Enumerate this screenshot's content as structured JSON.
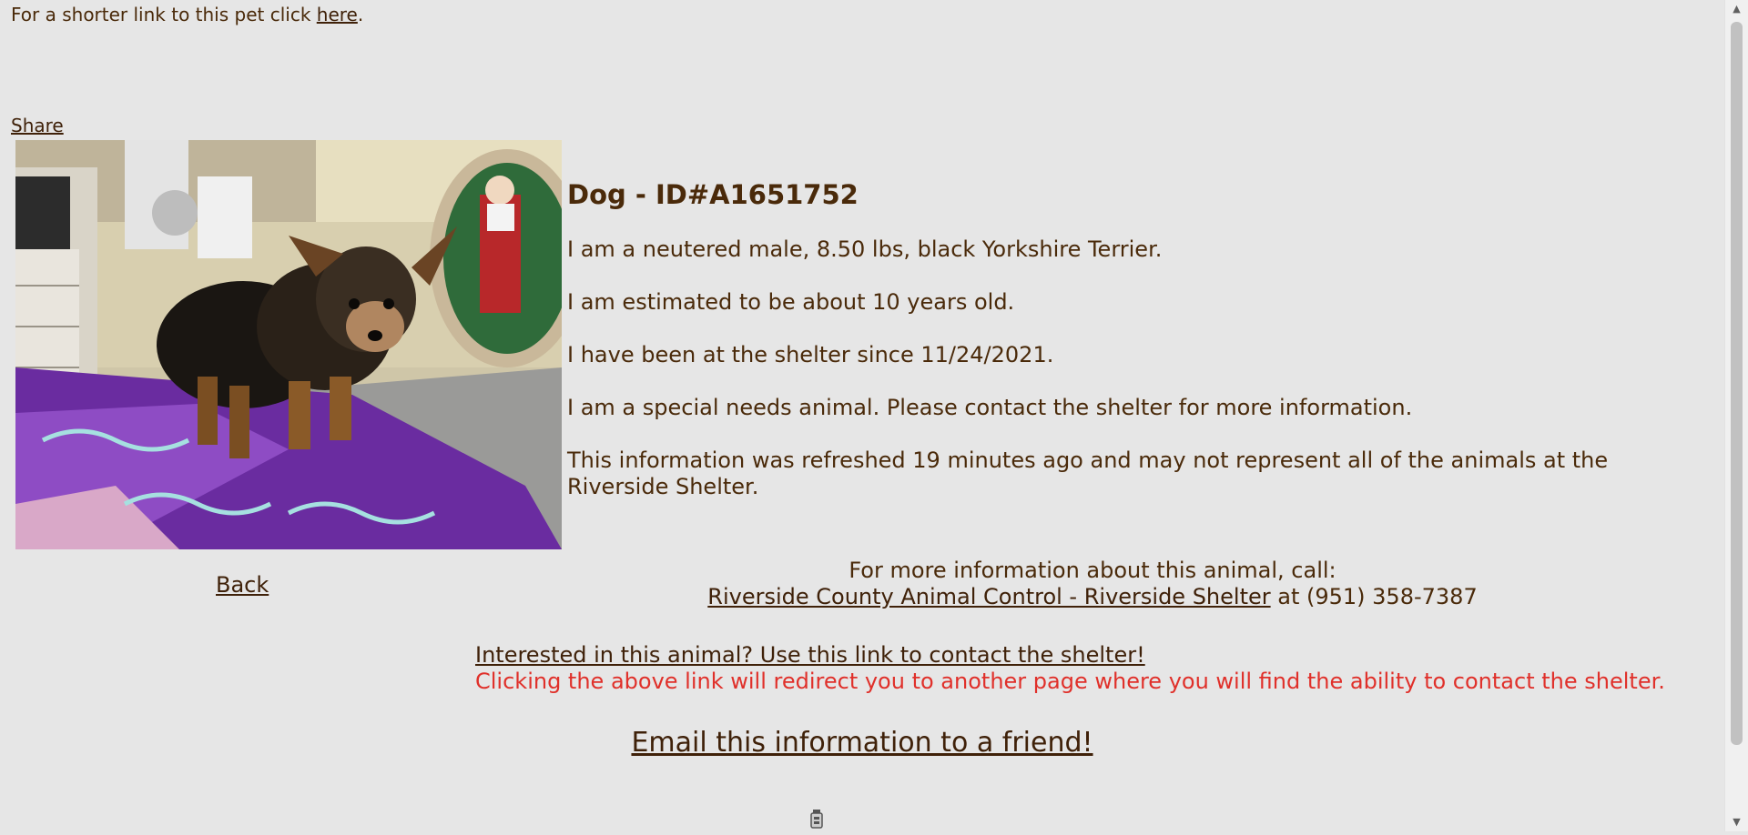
{
  "top": {
    "prefix": "For a shorter link to this pet click ",
    "here_link": "here",
    "suffix": "."
  },
  "share_label": "Share",
  "back_label": "Back",
  "animal": {
    "title": "Dog - ID#A1651752",
    "lines": [
      "I am a neutered male, 8.50 lbs, black Yorkshire Terrier.",
      "I am estimated to be about 10 years old.",
      "I have been at the shelter since 11/24/2021.",
      "I am a special needs animal. Please contact the shelter for more information.",
      "This information was refreshed 19 minutes ago and may not represent all of the animals at the Riverside Shelter."
    ]
  },
  "contact": {
    "intro": "For more information about this animal, call:",
    "shelter_link": "Riverside County Animal Control - Riverside Shelter",
    "phone_text": " at (951) 358-7387"
  },
  "interest": {
    "link": "Interested in this animal? Use this link to contact the shelter!",
    "note": "Clicking the above link will redirect you to another page where you will find the ability to contact the shelter.",
    "note_color": "#e0302a"
  },
  "email_link": "Email this information to a friend!",
  "icons": {
    "loader": "loading-spinner-icon",
    "scroll_up": "scroll-up-arrow-icon",
    "scroll_down": "scroll-down-arrow-icon"
  }
}
